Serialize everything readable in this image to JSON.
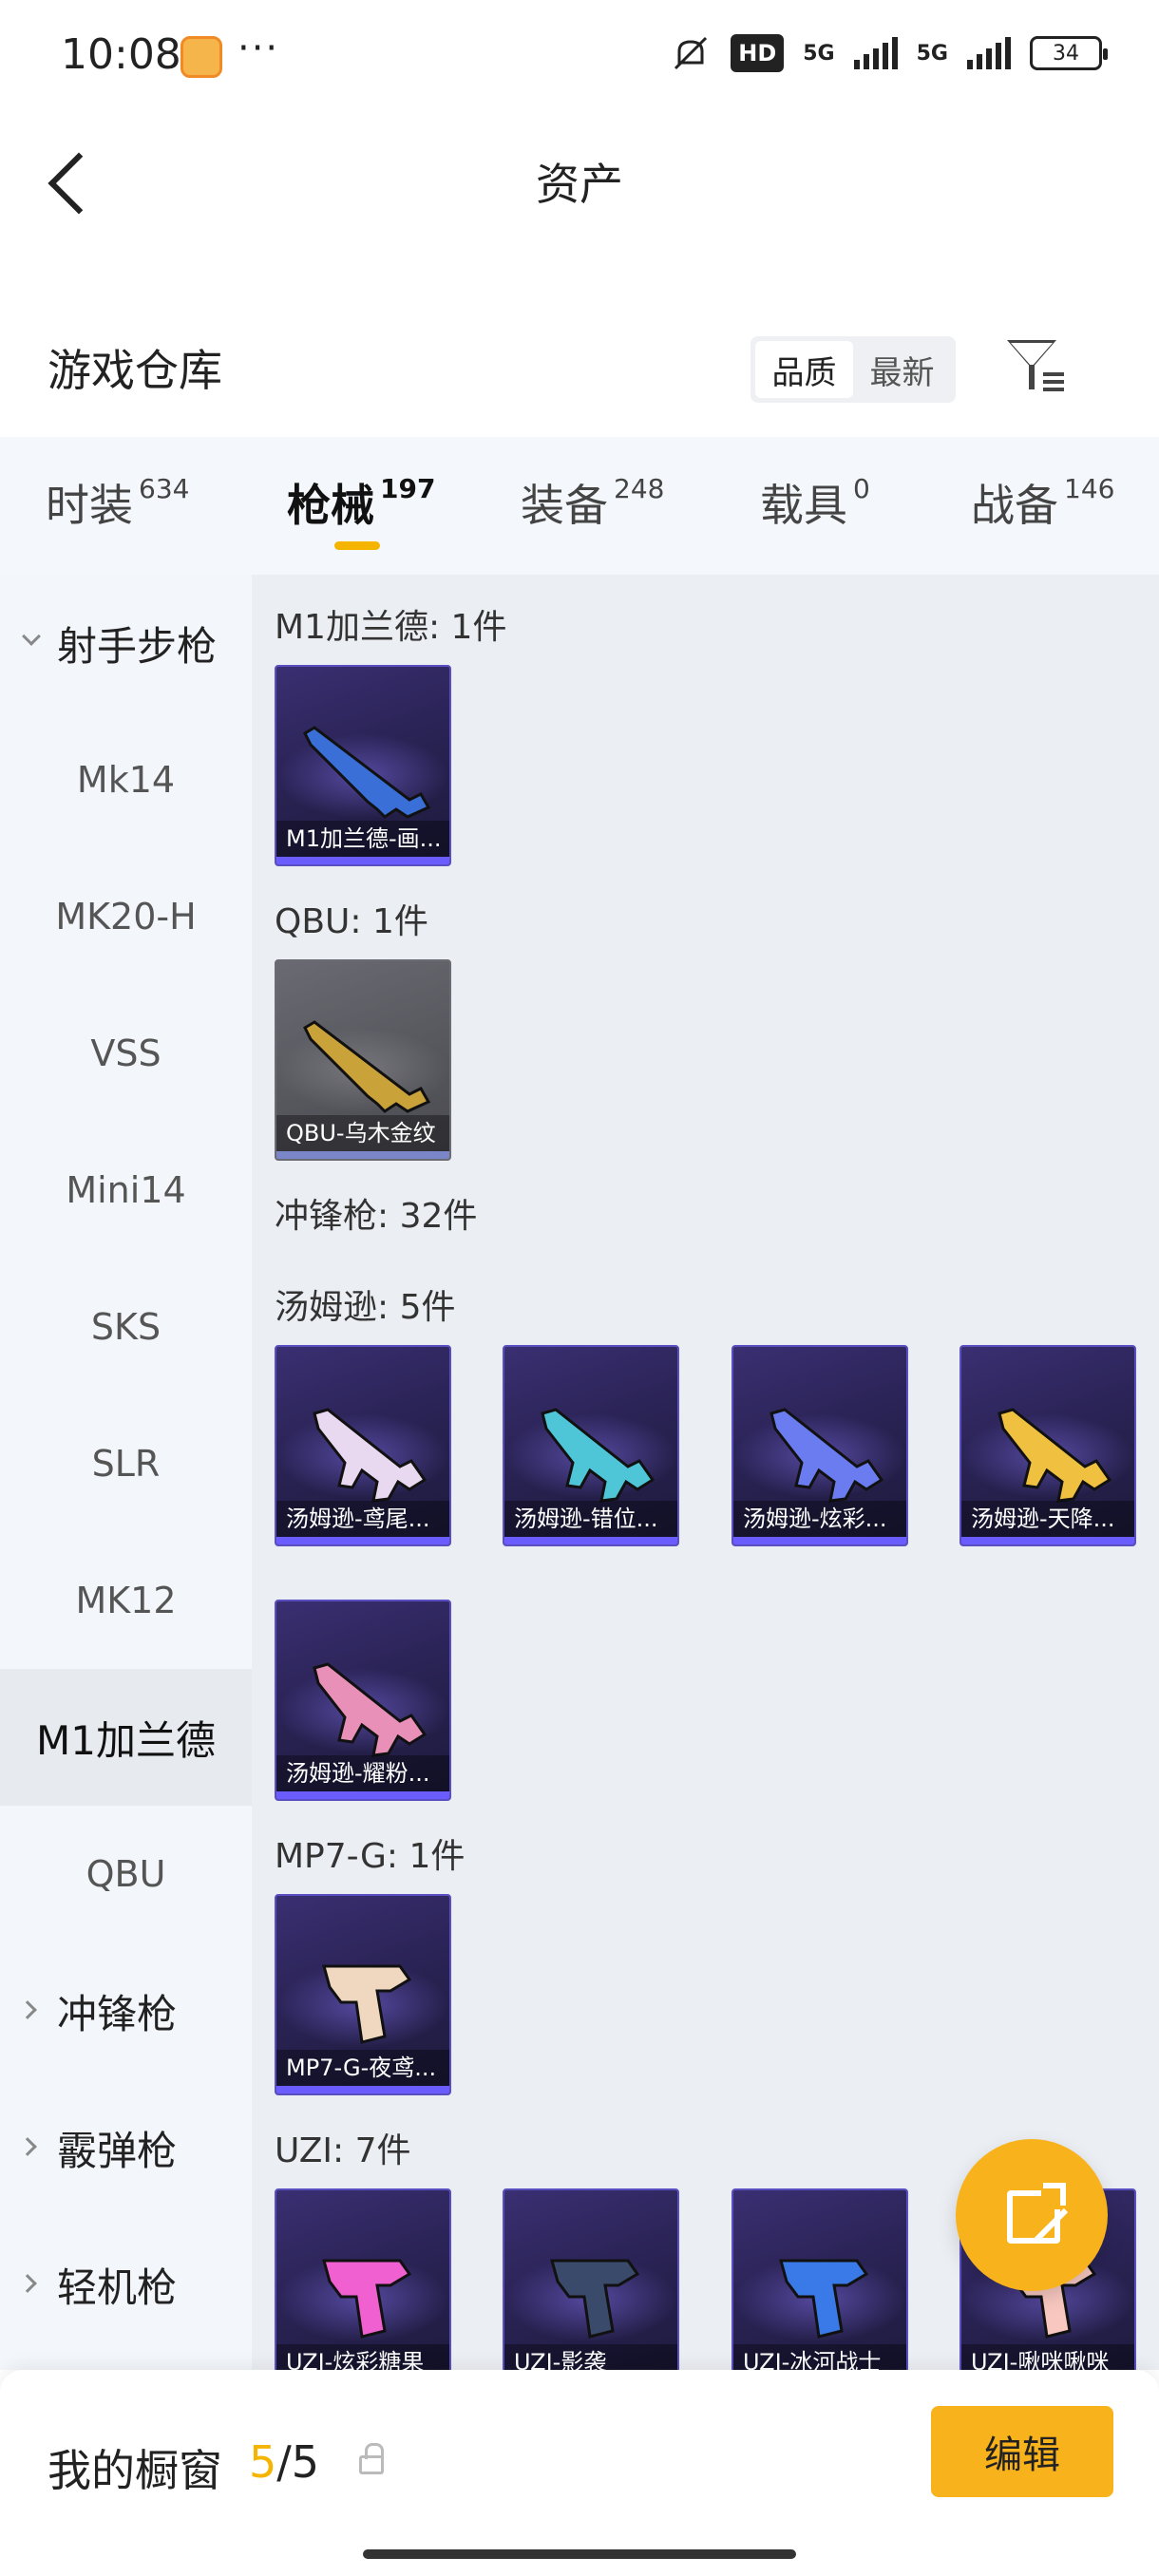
{
  "status": {
    "time": "10:08",
    "dots": "···",
    "hd": "HD",
    "net1": "5G",
    "net2": "5G",
    "battery": "34"
  },
  "header": {
    "title": "资产"
  },
  "warehouse": {
    "title": "游戏仓库",
    "sort_options": [
      "品质",
      "最新"
    ],
    "active_sort": "品质"
  },
  "tabs": [
    {
      "label": "时装",
      "count": "634"
    },
    {
      "label": "枪械",
      "count": "197"
    },
    {
      "label": "装备",
      "count": "248"
    },
    {
      "label": "载具",
      "count": "0"
    },
    {
      "label": "战备",
      "count": "146"
    }
  ],
  "active_tab": "枪械",
  "sidebar": [
    {
      "label": "射手步枪"
    },
    {
      "label": "Mk14"
    },
    {
      "label": "MK20-H"
    },
    {
      "label": "VSS"
    },
    {
      "label": "Mini14"
    },
    {
      "label": "SKS"
    },
    {
      "label": "SLR"
    },
    {
      "label": "MK12"
    },
    {
      "label": "M1加兰德"
    },
    {
      "label": "QBU"
    },
    {
      "label": "冲锋枪"
    },
    {
      "label": "霰弹枪"
    },
    {
      "label": "轻机枪"
    }
  ],
  "sections": [
    {
      "title": "M1加兰德: 1件"
    },
    {
      "title": "QBU: 1件"
    },
    {
      "title": "冲锋枪: 32件"
    },
    {
      "title": "汤姆逊: 5件"
    },
    {
      "title": "MP7-G: 1件"
    },
    {
      "title": "UZI: 7件"
    }
  ],
  "cards": [
    {
      "name": "M1加兰德-画...",
      "rarity": "epic",
      "color": "#3a6fd8"
    },
    {
      "name": "QBU-乌木金纹",
      "rarity": "rare",
      "color": "#c9a23a"
    },
    {
      "name": "汤姆逊-鸢尾...",
      "rarity": "epic",
      "color": "#e8d8f0"
    },
    {
      "name": "汤姆逊-错位...",
      "rarity": "epic",
      "color": "#4fc6d8"
    },
    {
      "name": "汤姆逊-炫彩...",
      "rarity": "epic",
      "color": "#6a7cf0"
    },
    {
      "name": "汤姆逊-天降...",
      "rarity": "epic",
      "color": "#f0c040"
    },
    {
      "name": "汤姆逊-耀粉...",
      "rarity": "epic",
      "color": "#e890b8"
    },
    {
      "name": "MP7-G-夜鸢...",
      "rarity": "epic",
      "color": "#f0d8c0"
    },
    {
      "name": "UZI-炫彩糖果",
      "rarity": "epic",
      "color": "#f060d0"
    },
    {
      "name": "UZI-影袭",
      "rarity": "epic",
      "color": "#3a4a6a"
    },
    {
      "name": "UZI-冰河战士",
      "rarity": "epic",
      "color": "#3a7ae8"
    },
    {
      "name": "UZI-啾咪啾咪",
      "rarity": "epic",
      "color": "#f8c8c0"
    }
  ],
  "bottom": {
    "label": "我的橱窗",
    "used": "5",
    "sep_total": "/5",
    "edit_label": "编辑"
  },
  "colors": {
    "accent": "#f8b21c",
    "card_bg": "#2a2355",
    "card_bar": "#6b5cff"
  }
}
